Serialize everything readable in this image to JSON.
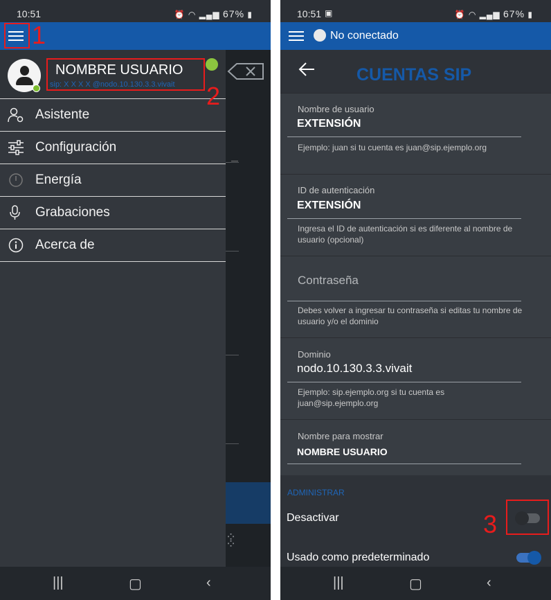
{
  "left_phone": {
    "status": {
      "time": "10:51",
      "battery": "67%"
    },
    "drawer": {
      "user_name": "NOMBRE USUARIO",
      "user_sip": "sip: X X X X @nodo.10.130.3.3.vivait",
      "items": [
        {
          "label": "Asistente",
          "icon": "assistant-user-icon"
        },
        {
          "label": "Configuración",
          "icon": "sliders-icon"
        },
        {
          "label": "Energía",
          "icon": "power-icon"
        },
        {
          "label": "Grabaciones",
          "icon": "microphone-icon"
        },
        {
          "label": "Acerca de",
          "icon": "info-icon"
        }
      ]
    },
    "annotations": [
      "1",
      "2"
    ]
  },
  "right_phone": {
    "status": {
      "time": "10:51",
      "battery": "67%"
    },
    "connection_status": "No conectado",
    "title": "CUENTAS SIP",
    "fields": [
      {
        "label": "Nombre de usuario",
        "value": "EXTENSIÓN",
        "help": "Ejemplo: juan si tu cuenta es juan@sip.ejemplo.org"
      },
      {
        "label": "ID de autenticación",
        "value": "EXTENSIÓN",
        "help": "Ingresa el ID de autenticación si es diferente al nombre de usuario (opcional)"
      },
      {
        "placeholder": "Contraseña",
        "help": "Debes volver a ingresar tu contraseña si editas tu nombre de usuario y/o el dominio"
      },
      {
        "label": "Dominio",
        "value": "nodo.10.130.3.3.vivait",
        "help": "Ejemplo: sip.ejemplo.org si tu cuenta es juan@sip.ejemplo.org"
      },
      {
        "label": "Nombre para mostrar",
        "value": "NOMBRE USUARIO"
      }
    ],
    "section_label": "ADMINISTRAR",
    "toggles": [
      {
        "label": "Desactivar",
        "on": false
      },
      {
        "label": "Usado como predeterminado",
        "on": true
      }
    ],
    "annotation": "3"
  }
}
